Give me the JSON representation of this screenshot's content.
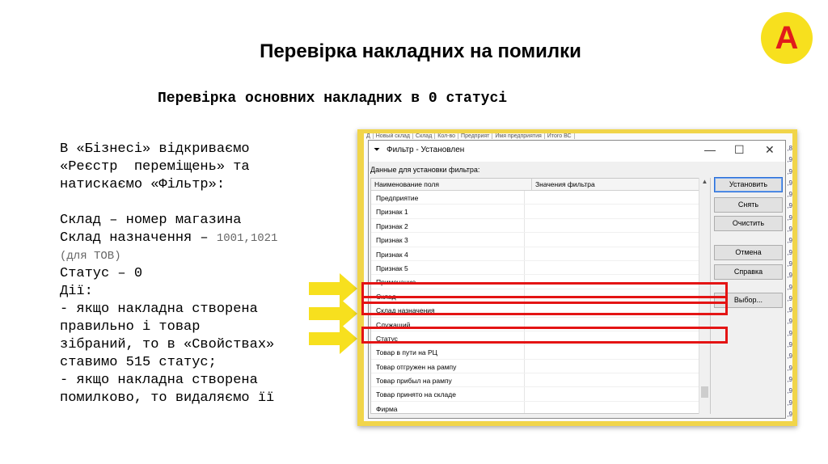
{
  "logo": {
    "letter": "A"
  },
  "title": "Перевірка накладних на помилки",
  "subtitle": "Перевірка основних накладних в 0 статусі",
  "instructions": {
    "l1": "В «Бізнесі» відкриваємо",
    "l2": "«Реєстр  переміщень» та",
    "l3": "натискаємо «Фільтр»:",
    "l4": "Склад – номер магазина",
    "l5a": "Склад назначення – ",
    "l5b": "1001,1021",
    "l6": "(для ТОВ)",
    "l7": "Статус – 0",
    "l8": "Дії:",
    "l9": "- якщо накладна створена",
    "l10": "правильно і товар",
    "l11": "зібраний, то в «Свойствах»",
    "l12": "ставимо 515 статус;",
    "l13": "- якщо накладна створена",
    "l14": "помилково, то видаляємо її"
  },
  "background_app": {
    "columns": [
      "Д",
      "Новый склад",
      "Склад",
      "Кол-во",
      "Предприят",
      "Имя предприятия",
      "Итого ВС"
    ],
    "right_digits": [
      ",8",
      ",9",
      ",9",
      ",9",
      ",9",
      ",9",
      ",9",
      ",9",
      ",9",
      ",9",
      ",9",
      ",9",
      ",9",
      ",9",
      ",9",
      ",9",
      ",9",
      ",9",
      ",9",
      ",9",
      ",9",
      ",9",
      ",9",
      ",9"
    ]
  },
  "dialog": {
    "title": "Фильтр - Установлен",
    "filter_icon": "filter-icon",
    "group_label": "Данные для установки фильтра:",
    "col_field": "Наименование поля",
    "col_value": "Значения фильтра",
    "rows": [
      "Предприятие",
      "Признак 1",
      "Признак 2",
      "Признак 3",
      "Признак 4",
      "Признак 5",
      "Примечание",
      "Склад",
      "Склад назначения",
      "Служащий",
      "Статус",
      "Товар в пути на РЦ",
      "Товар отгружен на рампу",
      "Товар прибыл на рампу",
      "Товар принято на складе",
      "Фирма"
    ],
    "buttons": {
      "set": "Установить",
      "remove": "Снять",
      "clear": "Очистить",
      "cancel": "Отмена",
      "help": "Справка",
      "choose": "Выбор..."
    },
    "window_buttons": {
      "minimize": "—",
      "maximize": "☐",
      "close": "✕"
    }
  },
  "colors": {
    "highlight": "#e41414",
    "arrow": "#f7e01e",
    "frame": "#f1d54a",
    "logo_bg": "#f7e01e",
    "logo_fg": "#e11b1b"
  }
}
